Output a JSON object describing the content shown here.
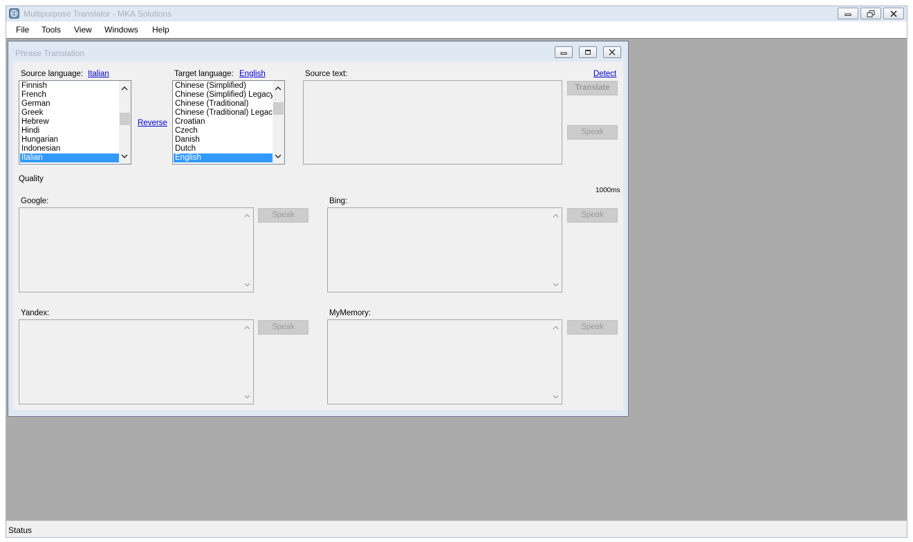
{
  "app": {
    "title": "Multipurpose Translator - MKA Solutions",
    "icon": "globe-icon"
  },
  "menu": [
    "File",
    "Tools",
    "View",
    "Windows",
    "Help"
  ],
  "status": "Status",
  "phrase_window": {
    "title": "Phrase Translation",
    "source_language_label": "Source language:",
    "source_language_value": "Italian",
    "target_language_label": "Target language:",
    "target_language_value": "English",
    "source_text_label": "Source text:",
    "detect_link": "Detect",
    "reverse_link": "Reverse",
    "translate_button": "Translate",
    "speak_button": "Speak",
    "quality_label": "Quality",
    "latency": "1000ms",
    "source_list": [
      "Finnish",
      "French",
      "German",
      "Greek",
      "Hebrew",
      "Hindi",
      "Hungarian",
      "Indonesian",
      "Italian"
    ],
    "source_selected": "Italian",
    "target_list": [
      "Chinese (Simplified)",
      "Chinese (Simplified) Legacy",
      "Chinese (Traditional)",
      "Chinese (Traditional) Legacy",
      "Croatian",
      "Czech",
      "Danish",
      "Dutch",
      "English"
    ],
    "target_selected": "English",
    "engines": {
      "google": "Google:",
      "bing": "Bing:",
      "yandex": "Yandex:",
      "mymemory": "MyMemory:"
    }
  },
  "colors": {
    "selection": "#3399ff",
    "link": "#0000d6",
    "mdi_background": "#ababab",
    "title_bar": "#dfe8f3"
  }
}
